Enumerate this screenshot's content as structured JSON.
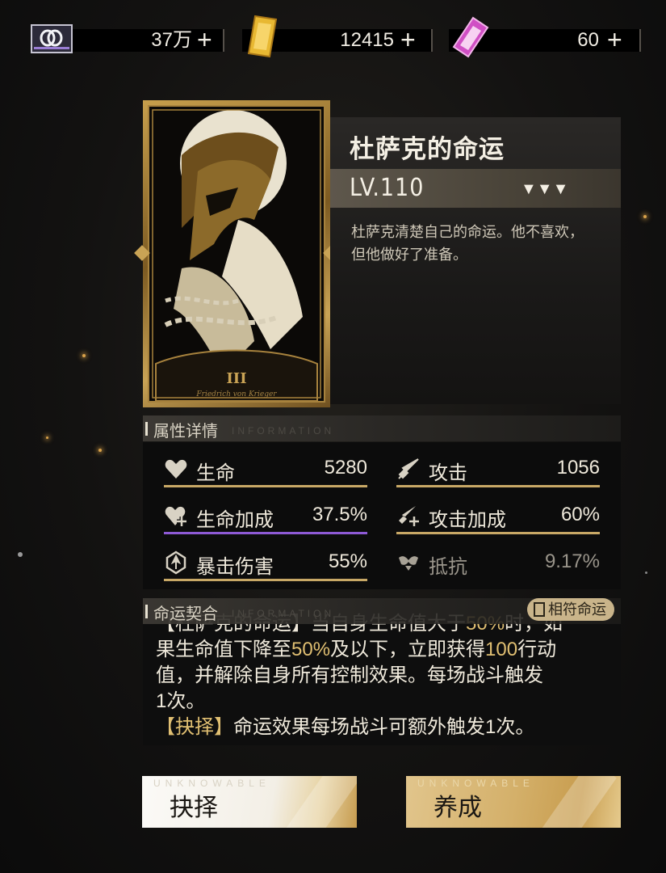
{
  "currencies": {
    "coin": {
      "icon": "ring-coin-icon",
      "value": "37万"
    },
    "gold": {
      "icon": "gold-bar-icon",
      "value": "12415"
    },
    "ticket": {
      "icon": "pink-ticket-icon",
      "value": "60"
    },
    "plus": "+"
  },
  "card": {
    "numeral": "III",
    "signature": "Friedrich von Krieger"
  },
  "info": {
    "title": "杜萨克的命运",
    "level": "LV.110",
    "stars": "▼▼▼",
    "description": "杜萨克清楚自己的命运。他不喜欢，但他做好了准备。"
  },
  "attributes": {
    "header": "属性详情",
    "header_en": "INFORMATION",
    "stats": [
      {
        "icon": "heart-icon",
        "name": "生命",
        "value": "5280"
      },
      {
        "icon": "sword-icon",
        "name": "攻击",
        "value": "1056"
      },
      {
        "icon": "heart-plus-icon",
        "name": "生命加成",
        "value": "37.5%"
      },
      {
        "icon": "sword-plus-icon",
        "name": "攻击加成",
        "value": "60%"
      },
      {
        "icon": "crit-damage-icon",
        "name": "暴击伤害",
        "value": "55%"
      },
      {
        "icon": "resist-icon",
        "name": "抵抗",
        "value": "9.17%"
      }
    ]
  },
  "fate": {
    "header": "命运契合",
    "header_en": "INFORMATION",
    "match_label": "相符命运",
    "line1_prefix": "【杜萨克的命运】当自身生命值大于",
    "line1_val": "50%",
    "line1_suffix": "时，如",
    "line2_prefix": "果生命值下降至",
    "line2_val": "50%",
    "line2_mid": "及以下，立即获得",
    "line2_val2": "100",
    "line2_suffix": "行动",
    "line3": "值，并解除自身所有控制效果。每场战斗触发",
    "line4": "1次。",
    "line5_tag": "【抉择】",
    "line5": "命运效果每场战斗可额外触发1次。"
  },
  "buttons": {
    "choose": "抉择",
    "cultivate": "养成",
    "watermark": "UNKNOWABLE"
  }
}
